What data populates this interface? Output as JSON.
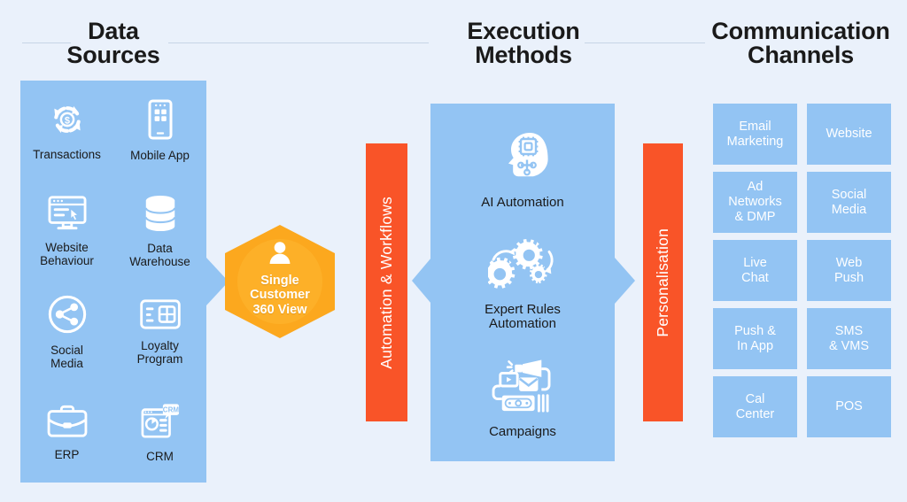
{
  "columns": {
    "data_sources_title": "Data\nSources",
    "execution_title": "Execution\nMethods",
    "communication_title": "Communication\nChannels"
  },
  "data_sources": {
    "items": [
      {
        "label": "Transactions",
        "icon": "transactions-icon"
      },
      {
        "label": "Mobile App",
        "icon": "mobile-app-icon"
      },
      {
        "label": "Website\nBehaviour",
        "icon": "website-behaviour-icon"
      },
      {
        "label": "Data\nWarehouse",
        "icon": "data-warehouse-icon"
      },
      {
        "label": "Social\nMedia",
        "icon": "social-media-icon"
      },
      {
        "label": "Loyalty\nProgram",
        "icon": "loyalty-program-icon"
      },
      {
        "label": "ERP",
        "icon": "erp-icon"
      },
      {
        "label": "CRM",
        "icon": "crm-icon"
      }
    ]
  },
  "hub": {
    "label": "Single\nCustomer\n360 View",
    "icon": "person-icon"
  },
  "connectors": {
    "automation_label": "Automation & Workflows",
    "personalisation_label": "Personalisation"
  },
  "execution": {
    "items": [
      {
        "label": "AI Automation",
        "icon": "ai-head-chip-icon"
      },
      {
        "label": "Expert Rules\nAutomation",
        "icon": "gears-icon"
      },
      {
        "label": "Campaigns",
        "icon": "campaigns-icon"
      }
    ]
  },
  "channels": {
    "items": [
      {
        "label": "Email\nMarketing"
      },
      {
        "label": "Website"
      },
      {
        "label": "Ad\nNetworks\n& DMP"
      },
      {
        "label": "Social\nMedia"
      },
      {
        "label": "Live\nChat"
      },
      {
        "label": "Web\nPush"
      },
      {
        "label": "Push &\nIn App"
      },
      {
        "label": "SMS\n& VMS"
      },
      {
        "label": "Cal\nCenter"
      },
      {
        "label": "POS"
      }
    ]
  },
  "colors": {
    "background": "#eaf1fb",
    "panel_blue": "#93c4f3",
    "accent_orange": "#fca81e",
    "accent_red": "#f95428",
    "title_text": "#1a1a1a",
    "rule": "#c7d4e6"
  }
}
